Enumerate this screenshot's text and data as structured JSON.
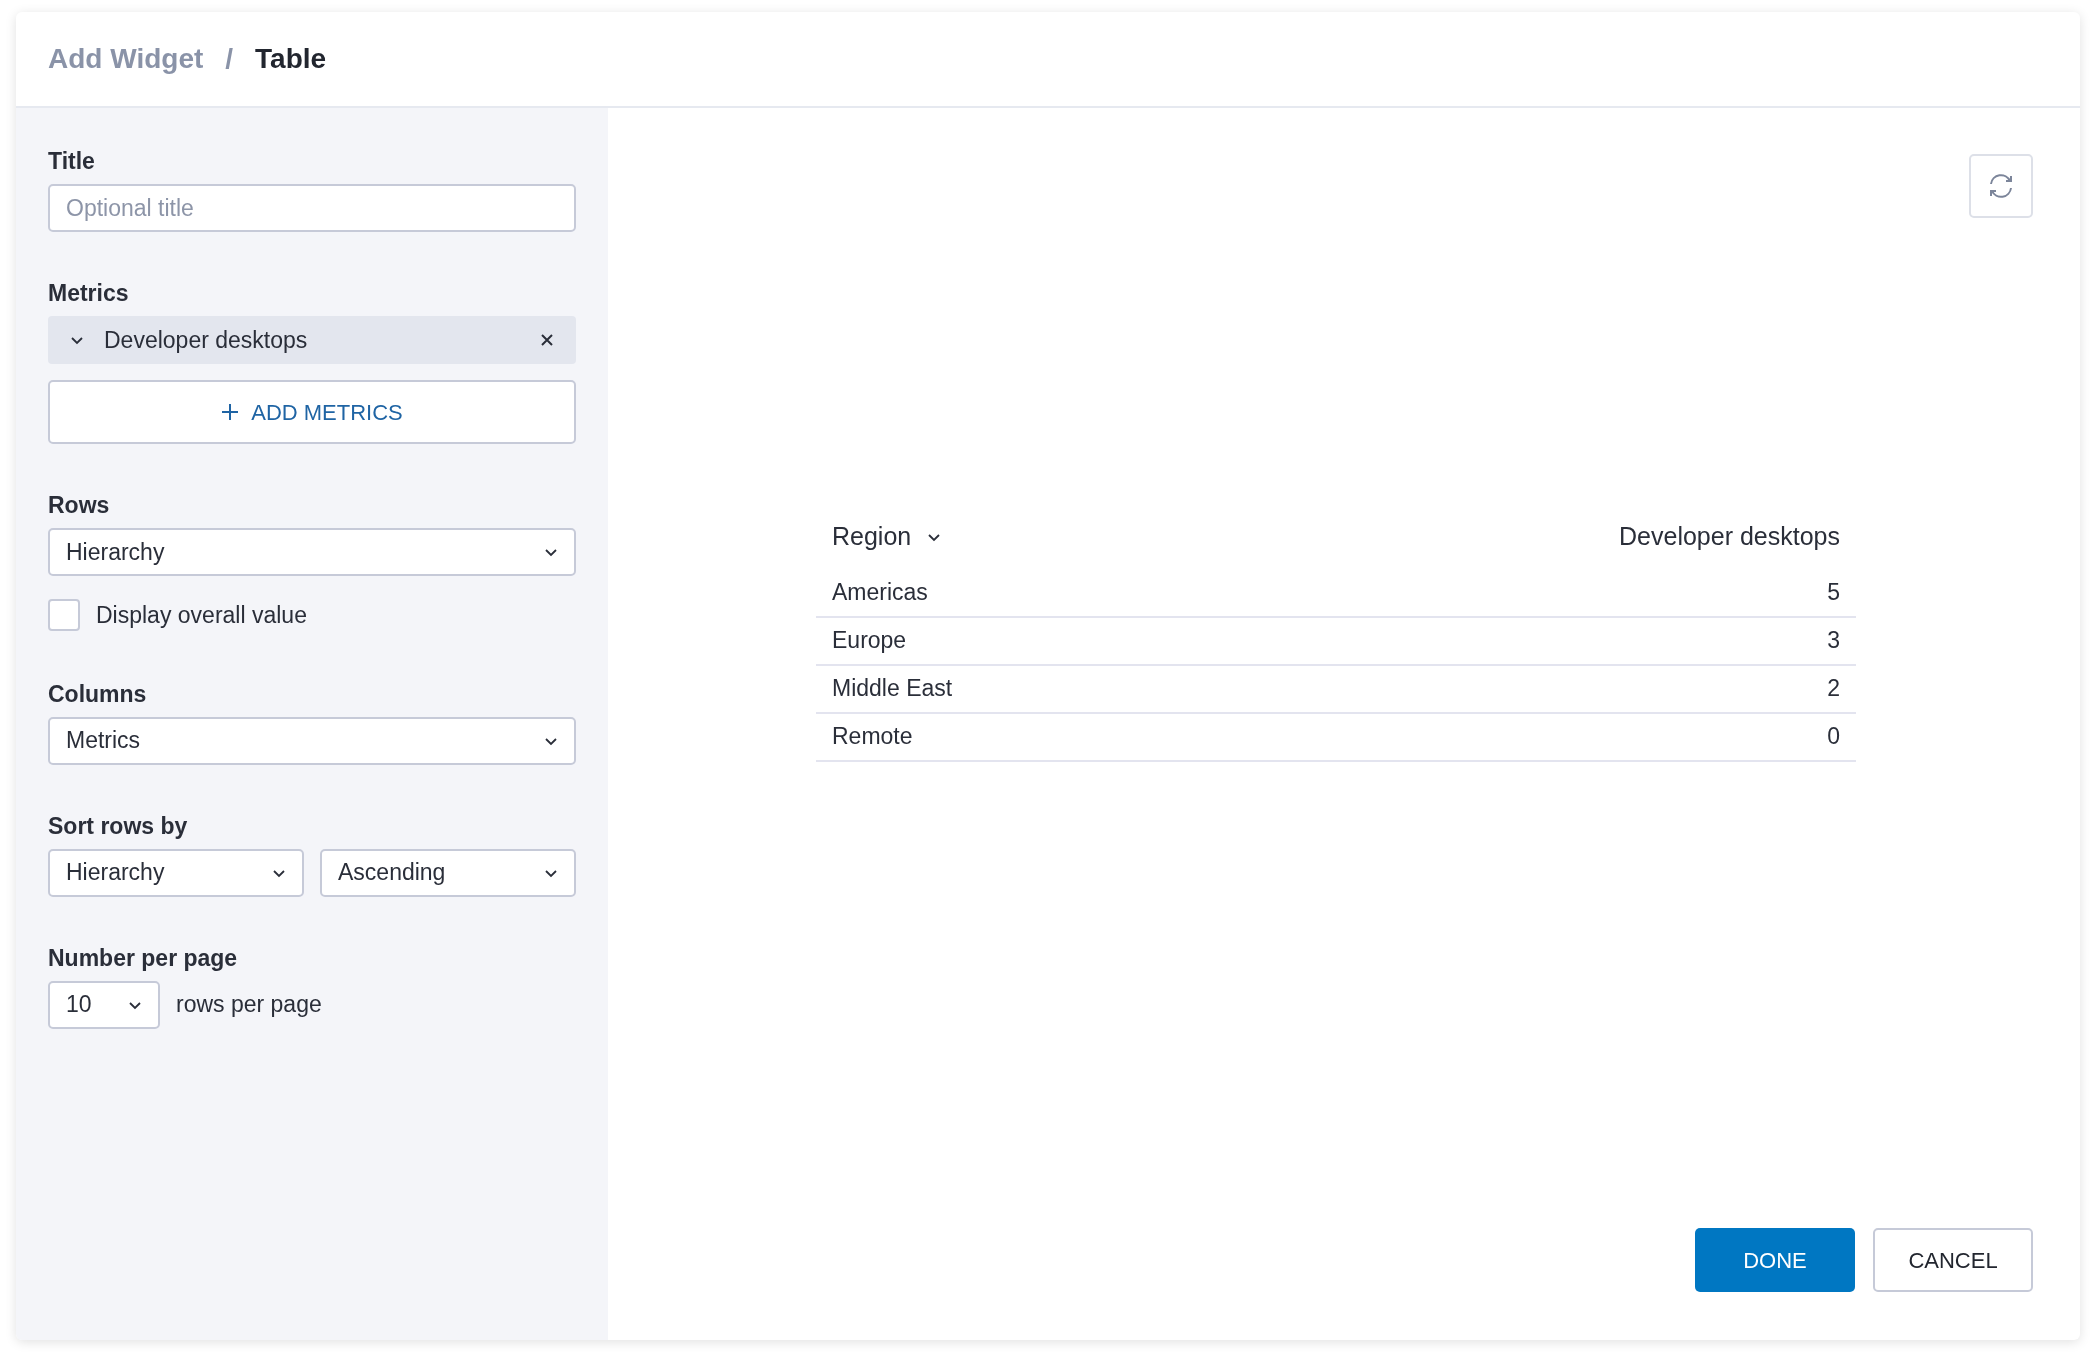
{
  "breadcrumb": [
    {
      "label": "Add Widget",
      "current": false
    },
    {
      "label": "Table",
      "current": true
    }
  ],
  "separator": "/",
  "form": {
    "title": {
      "label": "Title",
      "placeholder": "Optional title"
    },
    "metrics": {
      "label": "Metrics",
      "items": [
        {
          "name": "Developer desktops"
        }
      ],
      "add_button": "ADD METRICS"
    },
    "rows": {
      "label": "Rows",
      "value": "Hierarchy"
    },
    "display_overall": {
      "label": "Display overall value",
      "checked": false
    },
    "columns": {
      "label": "Columns",
      "value": "Metrics"
    },
    "sort": {
      "label": "Sort rows by",
      "field": "Hierarchy",
      "order": "Ascending"
    },
    "per_page": {
      "label": "Number per page",
      "value": "10",
      "suffix": "rows per page"
    }
  },
  "table": {
    "columns": [
      {
        "label": "Region",
        "sortable": true
      },
      {
        "label": "Developer desktops",
        "sortable": false
      }
    ],
    "rows": [
      [
        "Americas",
        "5"
      ],
      [
        "Europe",
        "3"
      ],
      [
        "Middle East",
        "2"
      ],
      [
        "Remote",
        "0"
      ]
    ]
  },
  "buttons": [
    {
      "label": "DONE",
      "kind": "primary"
    },
    {
      "label": "CANCEL",
      "kind": "secondary"
    }
  ]
}
